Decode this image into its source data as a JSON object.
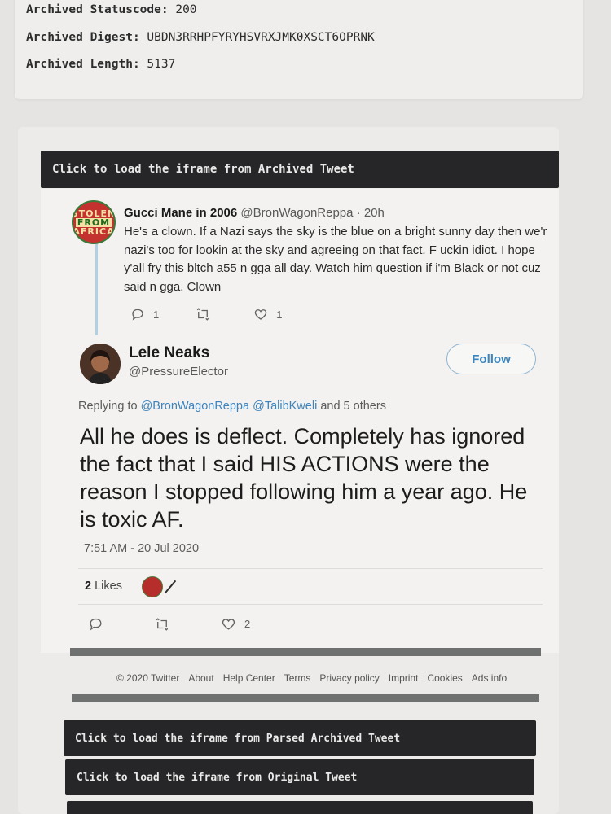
{
  "archive_meta": {
    "statuscode_label": "Archived Statuscode:",
    "statuscode_value": "200",
    "digest_label": "Archived Digest:",
    "digest_value": "UBDN3RRHPFYRYHSVRXJMK0XSCT6OPRNK",
    "length_label": "Archived Length:",
    "length_value": "5137"
  },
  "iframe_buttons": {
    "archived": "Click to load the iframe from Archived Tweet",
    "parsed": "Click to load the iframe from Parsed Archived Tweet",
    "original": "Click to load the iframe from Original Tweet"
  },
  "parent_tweet": {
    "name": "Gucci Mane in 2006",
    "handle": "@BronWagonReppa",
    "time": "· 20h",
    "text": "He's a clown. If a Nazi says the sky is the blue on a bright sunny day then we'r\nnazi's too for lookin at the sky and agreeing on that fact. F uckin idiot. I hope\ny'all fry this bltch a55 n gga all day. Watch him question if i'm Black or not cuz\nsaid n gga. Clown",
    "avatar_text": [
      "STOLEN",
      "FROM",
      "AFRICA"
    ],
    "reply_count": "1",
    "retweet_count": "",
    "like_count": "1"
  },
  "main_tweet": {
    "name": "Lele Neaks",
    "handle": "@PressureElector",
    "follow_label": "Follow",
    "replying_prefix": "Replying to",
    "replying_user1": "@BronWagonReppa",
    "replying_user2": "@TalibKweli",
    "replying_suffix": "and 5 others",
    "text": "All he does is deflect. Completely has ignored the fact that I said HIS ACTIONS were the reason I stopped following him a year ago. He is toxic AF.",
    "timestamp": "7:51 AM - 20 Jul 2020",
    "likes_count": "2",
    "likes_label": "Likes",
    "like_count": "2"
  },
  "footer_links": [
    "© 2020 Twitter",
    "About",
    "Help Center",
    "Terms",
    "Privacy policy",
    "Imprint",
    "Cookies",
    "Ads info"
  ],
  "colors": {
    "accent": "#3b84bc",
    "dark_bar": "#262628"
  }
}
